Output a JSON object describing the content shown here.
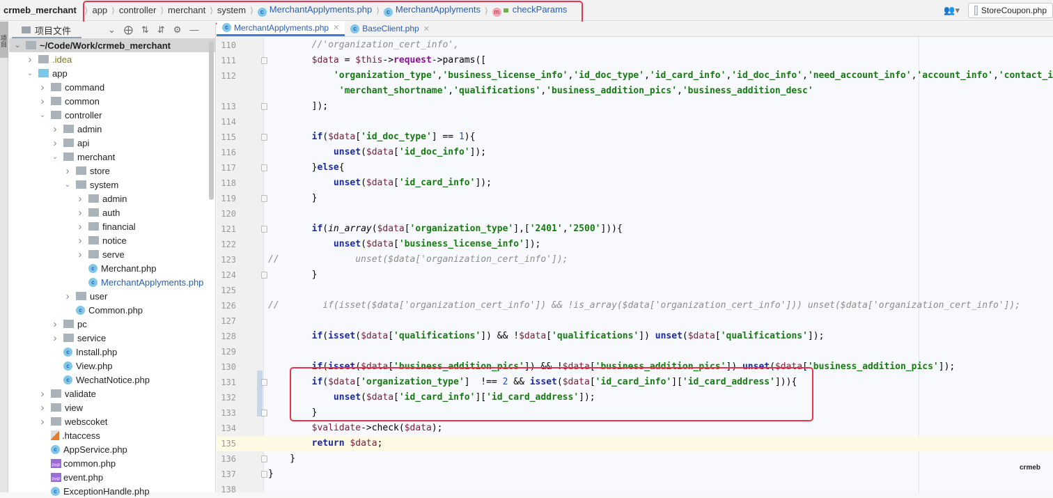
{
  "topbar": {
    "project": "crmeb_merchant",
    "breadcrumbs": [
      {
        "label": "app",
        "icon": null
      },
      {
        "label": "controller",
        "icon": null
      },
      {
        "label": "merchant",
        "icon": null
      },
      {
        "label": "system",
        "icon": null
      },
      {
        "label": "MerchantApplyments.php",
        "icon": "class-icon"
      },
      {
        "label": "MerchantApplyments",
        "icon": "class-icon"
      },
      {
        "label": "checkParams",
        "icon": "method-icon"
      }
    ],
    "class_icon_glyph": "c",
    "method_icon_glyph": "m",
    "run_config": "StoreCoupon.php",
    "user_icon": "user-icon"
  },
  "leftstrip": {
    "tab_label": "项目"
  },
  "sidebar": {
    "title": "项目文件",
    "tree": [
      {
        "label": "~/Code/Work/crmeb_merchant",
        "depth": 0,
        "type": "folder",
        "expanded": true,
        "selected": true
      },
      {
        "label": ".idea",
        "depth": 1,
        "type": "folder",
        "expanded": false,
        "style": "olive"
      },
      {
        "label": "app",
        "depth": 1,
        "type": "folder-blue",
        "expanded": true
      },
      {
        "label": "command",
        "depth": 2,
        "type": "folder",
        "expanded": false
      },
      {
        "label": "common",
        "depth": 2,
        "type": "folder",
        "expanded": false
      },
      {
        "label": "controller",
        "depth": 2,
        "type": "folder",
        "expanded": true
      },
      {
        "label": "admin",
        "depth": 3,
        "type": "folder",
        "expanded": false
      },
      {
        "label": "api",
        "depth": 3,
        "type": "folder",
        "expanded": false
      },
      {
        "label": "merchant",
        "depth": 3,
        "type": "folder",
        "expanded": true
      },
      {
        "label": "store",
        "depth": 4,
        "type": "folder",
        "expanded": false
      },
      {
        "label": "system",
        "depth": 4,
        "type": "folder",
        "expanded": true
      },
      {
        "label": "admin",
        "depth": 5,
        "type": "folder",
        "expanded": false
      },
      {
        "label": "auth",
        "depth": 5,
        "type": "folder",
        "expanded": false
      },
      {
        "label": "financial",
        "depth": 5,
        "type": "folder",
        "expanded": false
      },
      {
        "label": "notice",
        "depth": 5,
        "type": "folder",
        "expanded": false
      },
      {
        "label": "serve",
        "depth": 5,
        "type": "folder",
        "expanded": false
      },
      {
        "label": "Merchant.php",
        "depth": 5,
        "type": "class"
      },
      {
        "label": "MerchantApplyments.php",
        "depth": 5,
        "type": "class",
        "style": "blue"
      },
      {
        "label": "user",
        "depth": 4,
        "type": "folder",
        "expanded": false
      },
      {
        "label": "Common.php",
        "depth": 4,
        "type": "class"
      },
      {
        "label": "pc",
        "depth": 3,
        "type": "folder",
        "expanded": false
      },
      {
        "label": "service",
        "depth": 3,
        "type": "folder",
        "expanded": false
      },
      {
        "label": "Install.php",
        "depth": 3,
        "type": "class"
      },
      {
        "label": "View.php",
        "depth": 3,
        "type": "class"
      },
      {
        "label": "WechatNotice.php",
        "depth": 3,
        "type": "class"
      },
      {
        "label": "validate",
        "depth": 2,
        "type": "folder",
        "expanded": false
      },
      {
        "label": "view",
        "depth": 2,
        "type": "folder",
        "expanded": false
      },
      {
        "label": "webscoket",
        "depth": 2,
        "type": "folder",
        "expanded": false
      },
      {
        "label": ".htaccess",
        "depth": 2,
        "type": "htaccess"
      },
      {
        "label": "AppService.php",
        "depth": 2,
        "type": "class"
      },
      {
        "label": "common.php",
        "depth": 2,
        "type": "php"
      },
      {
        "label": "event.php",
        "depth": 2,
        "type": "php"
      },
      {
        "label": "ExceptionHandle.php",
        "depth": 2,
        "type": "class"
      }
    ]
  },
  "editor": {
    "tabs": [
      {
        "label": "MerchantApplyments.php",
        "active": true
      },
      {
        "label": "BaseClient.php",
        "active": false
      }
    ],
    "current_line": 135,
    "lines": [
      {
        "n": "110",
        "fold": false,
        "tokens": [
          [
            "cm",
            "        //'organization_cert_info',"
          ]
        ]
      },
      {
        "n": "111",
        "fold": true,
        "tokens": [
          [
            "",
            "        "
          ],
          [
            "var",
            "$data"
          ],
          [
            "",
            " = "
          ],
          [
            "var",
            "$this"
          ],
          [
            "",
            "->"
          ],
          [
            "prop",
            "request"
          ],
          [
            "",
            "->params(["
          ]
        ]
      },
      {
        "n": "112",
        "fold": false,
        "tokens": [
          [
            "",
            "            "
          ],
          [
            "str",
            "'organization_type'"
          ],
          [
            "",
            ","
          ],
          [
            "str",
            "'business_license_info'"
          ],
          [
            "",
            ","
          ],
          [
            "str",
            "'id_doc_type'"
          ],
          [
            "",
            ","
          ],
          [
            "str",
            "'id_card_info'"
          ],
          [
            "",
            ","
          ],
          [
            "str",
            "'id_doc_info'"
          ],
          [
            "",
            ","
          ],
          [
            "str",
            "'need_account_info'"
          ],
          [
            "",
            ","
          ],
          [
            "str",
            "'account_info'"
          ],
          [
            "",
            ","
          ],
          [
            "str",
            "'contact_info'"
          ]
        ]
      },
      {
        "n": "",
        "fold": false,
        "tokens": [
          [
            "",
            "             "
          ],
          [
            "str",
            "'merchant_shortname'"
          ],
          [
            "",
            ","
          ],
          [
            "str",
            "'qualifications'"
          ],
          [
            "",
            ","
          ],
          [
            "str",
            "'business_addition_pics'"
          ],
          [
            "",
            ","
          ],
          [
            "str",
            "'business_addition_desc'"
          ]
        ]
      },
      {
        "n": "113",
        "fold": true,
        "tokens": [
          [
            "",
            "        ]);"
          ]
        ]
      },
      {
        "n": "114",
        "fold": false,
        "tokens": []
      },
      {
        "n": "115",
        "fold": true,
        "tokens": [
          [
            "",
            "        "
          ],
          [
            "kw",
            "if"
          ],
          [
            "",
            "("
          ],
          [
            "var",
            "$data"
          ],
          [
            "",
            "["
          ],
          [
            "str",
            "'id_doc_type'"
          ],
          [
            "",
            "] == "
          ],
          [
            "num",
            "1"
          ],
          [
            "",
            "){"
          ]
        ]
      },
      {
        "n": "116",
        "fold": false,
        "tokens": [
          [
            "",
            "            "
          ],
          [
            "kw",
            "unset"
          ],
          [
            "",
            "("
          ],
          [
            "var",
            "$data"
          ],
          [
            "",
            "["
          ],
          [
            "str",
            "'id_doc_info'"
          ],
          [
            "",
            "]);"
          ]
        ]
      },
      {
        "n": "117",
        "fold": true,
        "tokens": [
          [
            "",
            "        }"
          ],
          [
            "kw",
            "else"
          ],
          [
            "",
            "{"
          ]
        ]
      },
      {
        "n": "118",
        "fold": false,
        "tokens": [
          [
            "",
            "            "
          ],
          [
            "kw",
            "unset"
          ],
          [
            "",
            "("
          ],
          [
            "var",
            "$data"
          ],
          [
            "",
            "["
          ],
          [
            "str",
            "'id_card_info'"
          ],
          [
            "",
            "]);"
          ]
        ]
      },
      {
        "n": "119",
        "fold": true,
        "tokens": [
          [
            "",
            "        }"
          ]
        ]
      },
      {
        "n": "120",
        "fold": false,
        "tokens": []
      },
      {
        "n": "121",
        "fold": true,
        "tokens": [
          [
            "",
            "        "
          ],
          [
            "kw",
            "if"
          ],
          [
            "",
            "("
          ],
          [
            "fn",
            "in_array"
          ],
          [
            "",
            "("
          ],
          [
            "var",
            "$data"
          ],
          [
            "",
            "["
          ],
          [
            "str",
            "'organization_type'"
          ],
          [
            "",
            "],["
          ],
          [
            "str",
            "'2401'"
          ],
          [
            "",
            ","
          ],
          [
            "str",
            "'2500'"
          ],
          [
            "",
            "])){"
          ]
        ]
      },
      {
        "n": "122",
        "fold": false,
        "tokens": [
          [
            "",
            "            "
          ],
          [
            "kw",
            "unset"
          ],
          [
            "",
            "("
          ],
          [
            "var",
            "$data"
          ],
          [
            "",
            "["
          ],
          [
            "str",
            "'business_license_info'"
          ],
          [
            "",
            "]);"
          ]
        ]
      },
      {
        "n": "123",
        "fold": false,
        "tokens": [
          [
            "cm",
            "//              unset($data['organization_cert_info']);"
          ]
        ]
      },
      {
        "n": "124",
        "fold": true,
        "tokens": [
          [
            "",
            "        }"
          ]
        ]
      },
      {
        "n": "125",
        "fold": false,
        "tokens": []
      },
      {
        "n": "126",
        "fold": false,
        "tokens": [
          [
            "cm",
            "//        if(isset($data['organization_cert_info']) && !is_array($data['organization_cert_info'])) unset($data['organization_cert_info']);"
          ]
        ]
      },
      {
        "n": "127",
        "fold": false,
        "tokens": []
      },
      {
        "n": "128",
        "fold": false,
        "tokens": [
          [
            "",
            "        "
          ],
          [
            "kw",
            "if"
          ],
          [
            "",
            "("
          ],
          [
            "kw",
            "isset"
          ],
          [
            "",
            "("
          ],
          [
            "var",
            "$data"
          ],
          [
            "",
            "["
          ],
          [
            "str",
            "'qualifications'"
          ],
          [
            "",
            "]) && !"
          ],
          [
            "var",
            "$data"
          ],
          [
            "",
            "["
          ],
          [
            "str",
            "'qualifications'"
          ],
          [
            "",
            "]) "
          ],
          [
            "kw",
            "unset"
          ],
          [
            "",
            "("
          ],
          [
            "var",
            "$data"
          ],
          [
            "",
            "["
          ],
          [
            "str",
            "'qualifications'"
          ],
          [
            "",
            "]);"
          ]
        ]
      },
      {
        "n": "129",
        "fold": false,
        "tokens": []
      },
      {
        "n": "130",
        "fold": false,
        "tokens": [
          [
            "",
            "        "
          ],
          [
            "kw",
            "if"
          ],
          [
            "",
            "("
          ],
          [
            "kw",
            "isset"
          ],
          [
            "",
            "("
          ],
          [
            "var",
            "$data"
          ],
          [
            "",
            "["
          ],
          [
            "str",
            "'business_addition_pics'"
          ],
          [
            "",
            "]) && !"
          ],
          [
            "var",
            "$data"
          ],
          [
            "",
            "["
          ],
          [
            "str",
            "'business_addition_pics'"
          ],
          [
            "",
            "]) "
          ],
          [
            "kw",
            "unset"
          ],
          [
            "",
            "("
          ],
          [
            "var",
            "$data"
          ],
          [
            "",
            "["
          ],
          [
            "str",
            "'business_addition_pics'"
          ],
          [
            "",
            "]);"
          ]
        ]
      },
      {
        "n": "131",
        "fold": true,
        "tokens": [
          [
            "",
            "        "
          ],
          [
            "kw",
            "if"
          ],
          [
            "",
            "("
          ],
          [
            "var",
            "$data"
          ],
          [
            "",
            "["
          ],
          [
            "str",
            "'organization_type'"
          ],
          [
            "",
            "]  !== "
          ],
          [
            "num",
            "2"
          ],
          [
            "",
            " && "
          ],
          [
            "kw",
            "isset"
          ],
          [
            "",
            "("
          ],
          [
            "var",
            "$data"
          ],
          [
            "",
            "["
          ],
          [
            "str",
            "'id_card_info'"
          ],
          [
            "",
            "]["
          ],
          [
            "str",
            "'id_card_address'"
          ],
          [
            "",
            "])){"
          ]
        ]
      },
      {
        "n": "132",
        "fold": false,
        "tokens": [
          [
            "",
            "            "
          ],
          [
            "kw",
            "unset"
          ],
          [
            "",
            "("
          ],
          [
            "var",
            "$data"
          ],
          [
            "",
            "["
          ],
          [
            "str",
            "'id_card_info'"
          ],
          [
            "",
            "]["
          ],
          [
            "str",
            "'id_card_address'"
          ],
          [
            "",
            "]);"
          ]
        ]
      },
      {
        "n": "133",
        "fold": true,
        "tokens": [
          [
            "",
            "        }"
          ]
        ]
      },
      {
        "n": "134",
        "fold": false,
        "tokens": [
          [
            "",
            "        "
          ],
          [
            "var",
            "$validate"
          ],
          [
            "",
            "->check("
          ],
          [
            "var",
            "$data"
          ],
          [
            "",
            ");"
          ]
        ]
      },
      {
        "n": "135",
        "fold": false,
        "tokens": [
          [
            "",
            "        "
          ],
          [
            "kw",
            "return"
          ],
          [
            "",
            " "
          ],
          [
            "var",
            "$data"
          ],
          [
            "",
            ";"
          ]
        ]
      },
      {
        "n": "136",
        "fold": true,
        "tokens": [
          [
            "",
            "    }"
          ]
        ]
      },
      {
        "n": "137",
        "fold": true,
        "tokens": [
          [
            "",
            "}"
          ]
        ]
      },
      {
        "n": "138",
        "fold": false,
        "tokens": []
      }
    ],
    "watermark": "crmeb"
  }
}
